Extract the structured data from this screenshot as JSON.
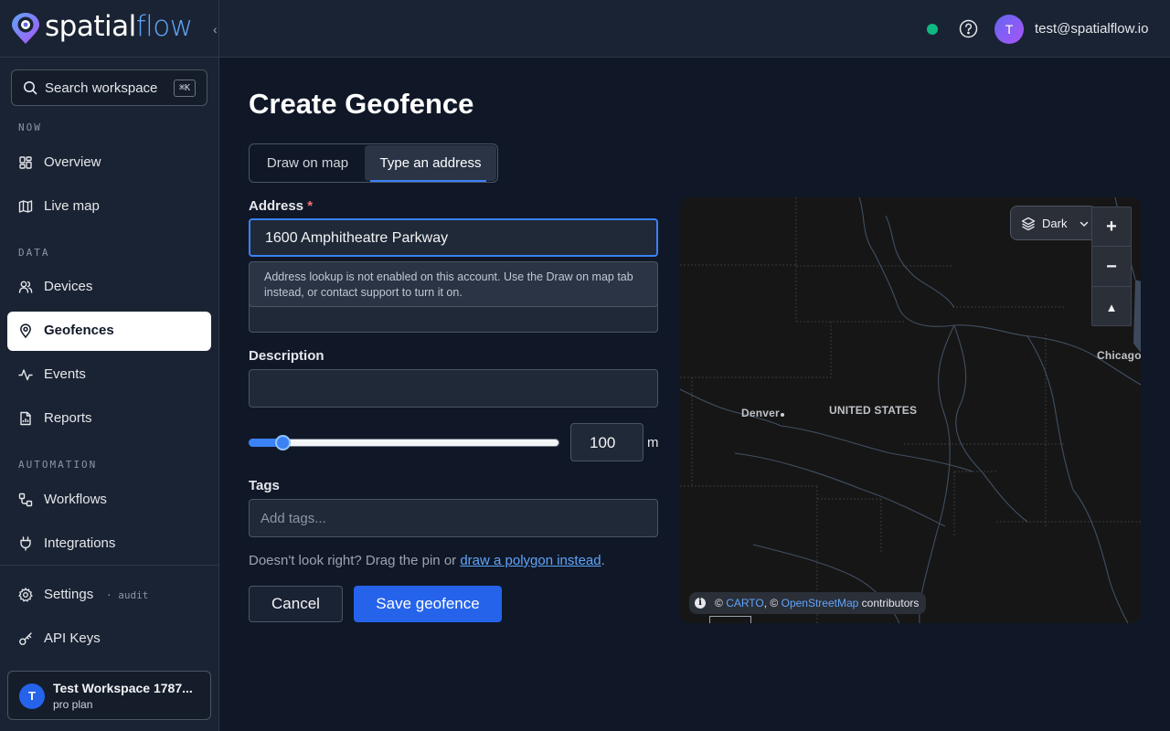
{
  "app": {
    "logo_part1": "spatial",
    "logo_part2": "flow",
    "collapse_glyph": "‹"
  },
  "sidebar": {
    "search": {
      "label": "Search workspace",
      "shortcut": "⌘K",
      "icon": "search-icon"
    },
    "sections": [
      {
        "label": "NOW"
      },
      {
        "label": "DATA"
      },
      {
        "label": "AUTOMATION"
      }
    ],
    "items": [
      {
        "label": "Overview",
        "icon": "dashboard-icon"
      },
      {
        "label": "Live map",
        "icon": "map-icon"
      },
      {
        "label": "Devices",
        "icon": "users-icon"
      },
      {
        "label": "Geofences",
        "icon": "map-pin-icon",
        "active": true
      },
      {
        "label": "Events",
        "icon": "activity-icon"
      },
      {
        "label": "Reports",
        "icon": "report-icon"
      },
      {
        "label": "Workflows",
        "icon": "workflow-icon"
      },
      {
        "label": "Integrations",
        "icon": "plug-icon"
      },
      {
        "label": "Settings",
        "icon": "gear-icon",
        "tag": "· audit"
      },
      {
        "label": "API Keys",
        "icon": "key-icon"
      }
    ],
    "workspace": {
      "initial": "T",
      "name": "Test Workspace 1787...",
      "plan": "pro plan"
    }
  },
  "topbar": {
    "status_color": "#10b981",
    "user_initial": "T",
    "user_email": "test@spatialflow.io"
  },
  "form": {
    "title": "Create Geofence",
    "tabs": [
      {
        "label": "Draw on map",
        "selected": false
      },
      {
        "label": "Type an address",
        "selected": true
      }
    ],
    "address_label": "Address",
    "required_mark": "*",
    "address_value": "1600 Amphitheatre Parkway",
    "address_notice": "Address lookup is not enabled on this account. Use the Draw on map tab instead, or contact support to turn it on.",
    "description_label": "Description",
    "description_value": "",
    "radius_value": "100",
    "radius_unit": "m",
    "radius_slider_fraction": 0.11,
    "tags_label": "Tags",
    "tags_placeholder": "Add tags...",
    "hint_prefix": "Doesn't look right? Drag the pin or ",
    "hint_link": "draw a polygon instead",
    "hint_suffix": ".",
    "cancel_label": "Cancel",
    "save_label": "Save geofence"
  },
  "map": {
    "style_label": "Dark",
    "zoom_in": "+",
    "zoom_out": "−",
    "compass": "▲",
    "labels": {
      "chicago": "Chicago",
      "denver": "Denver",
      "us": "UNITED STATES"
    },
    "attribution": {
      "prefix": "© ",
      "carto": "CARTO",
      "mid": ", © ",
      "osm": "OpenStreetMap",
      "suffix": " contributors"
    },
    "accent_color": "#60a5fa"
  }
}
